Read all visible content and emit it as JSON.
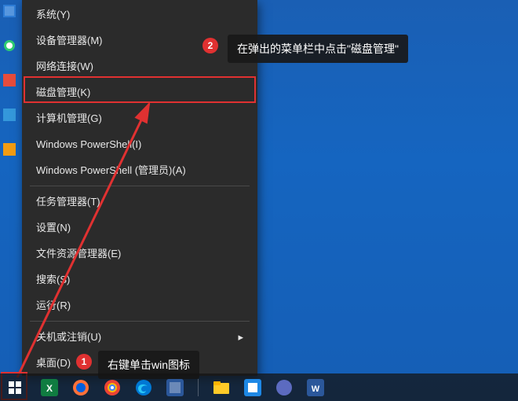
{
  "menu": {
    "items": [
      {
        "label": "系统(Y)"
      },
      {
        "label": "设备管理器(M)"
      },
      {
        "label": "网络连接(W)"
      },
      {
        "label": "磁盘管理(K)"
      },
      {
        "label": "计算机管理(G)"
      },
      {
        "label": "Windows PowerShell(I)"
      },
      {
        "label": "Windows PowerShell (管理员)(A)"
      }
    ],
    "items2": [
      {
        "label": "任务管理器(T)"
      },
      {
        "label": "设置(N)"
      },
      {
        "label": "文件资源管理器(E)"
      },
      {
        "label": "搜索(S)"
      },
      {
        "label": "运行(R)"
      }
    ],
    "items3": [
      {
        "label": "关机或注销(U)"
      },
      {
        "label": "桌面(D)"
      }
    ]
  },
  "annotations": {
    "badge1": "1",
    "badge2": "2",
    "callout1": "右键单击win图标",
    "callout2": "在弹出的菜单栏中点击\"磁盘管理\""
  }
}
